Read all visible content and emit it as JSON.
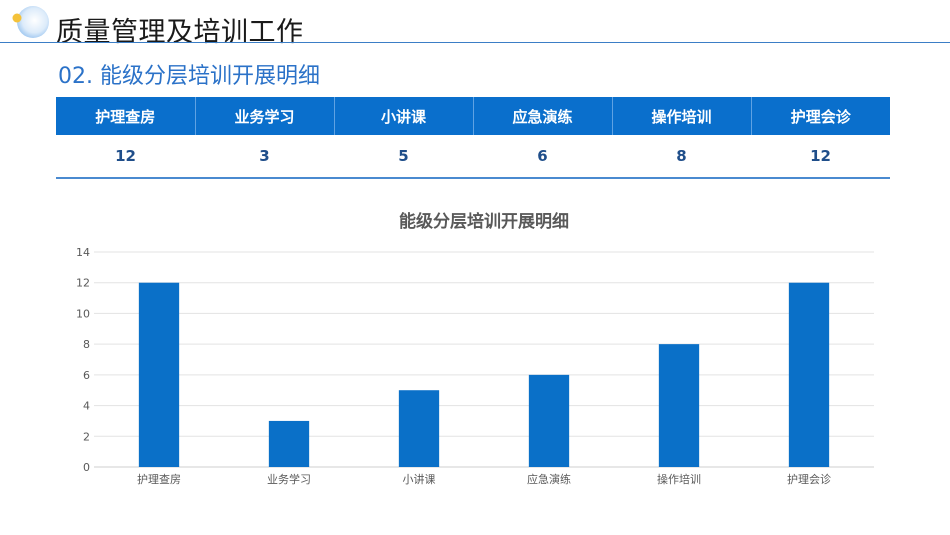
{
  "page": {
    "title": "质量管理及培训工作",
    "subtitle": "02. 能级分层培训开展明细"
  },
  "table": {
    "headers": [
      "护理查房",
      "业务学习",
      "小讲课",
      "应急演练",
      "操作培训",
      "护理会诊"
    ],
    "values": [
      "12",
      "3",
      "5",
      "6",
      "8",
      "12"
    ]
  },
  "chart_data": {
    "type": "bar",
    "title": "能级分层培训开展明细",
    "categories": [
      "护理查房",
      "业务学习",
      "小讲课",
      "应急演练",
      "操作培训",
      "护理会诊"
    ],
    "values": [
      12,
      3,
      5,
      6,
      8,
      12
    ],
    "xlabel": "",
    "ylabel": "",
    "ylim": [
      0,
      14
    ],
    "yticks": [
      0,
      2,
      4,
      6,
      8,
      10,
      12,
      14
    ],
    "grid": true,
    "legend": "none",
    "bar_color": "#0a70c8"
  }
}
